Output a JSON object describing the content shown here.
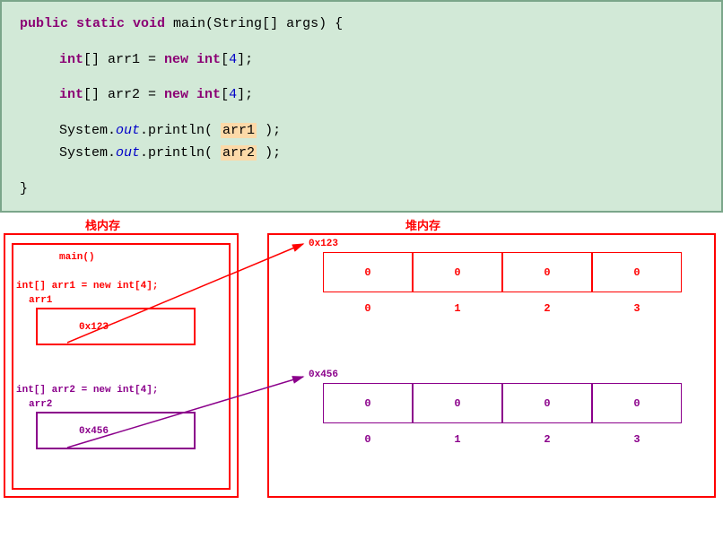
{
  "code": {
    "line1": {
      "kw": "public static void",
      "name": "main(String[] args) {"
    },
    "line2": {
      "type": "int",
      "brackets": "[] ",
      "var": "arr1 = ",
      "newkw": "new int",
      "bracket_open": "[",
      "size": "4",
      "bracket_close": "];"
    },
    "line3": {
      "type": "int",
      "brackets": "[] ",
      "var": "arr2 = ",
      "newkw": "new int",
      "bracket_open": "[",
      "size": "4",
      "bracket_close": "];"
    },
    "line4": {
      "sys": "System.",
      "out": "out",
      "mid": ".println( ",
      "arg": "arr1",
      "end": " );"
    },
    "line5": {
      "sys": "System.",
      "out": "out",
      "mid": ".println( ",
      "arg": "arr2",
      "end": " );"
    },
    "line6": "}"
  },
  "diagram": {
    "stack_label": "栈内存",
    "heap_label": "堆内存",
    "main_label": "main()",
    "decl1": "int[] arr1 = new int[4];",
    "var1": "arr1",
    "addr1": "0x123",
    "decl2": "int[] arr2 = new int[4];",
    "var2": "arr2",
    "addr2": "0x456",
    "heap_addr1": "0x123",
    "heap_addr2": "0x456",
    "arr1_values": [
      "0",
      "0",
      "0",
      "0"
    ],
    "arr1_indices": [
      "0",
      "1",
      "2",
      "3"
    ],
    "arr2_values": [
      "0",
      "0",
      "0",
      "0"
    ],
    "arr2_indices": [
      "0",
      "1",
      "2",
      "3"
    ]
  }
}
